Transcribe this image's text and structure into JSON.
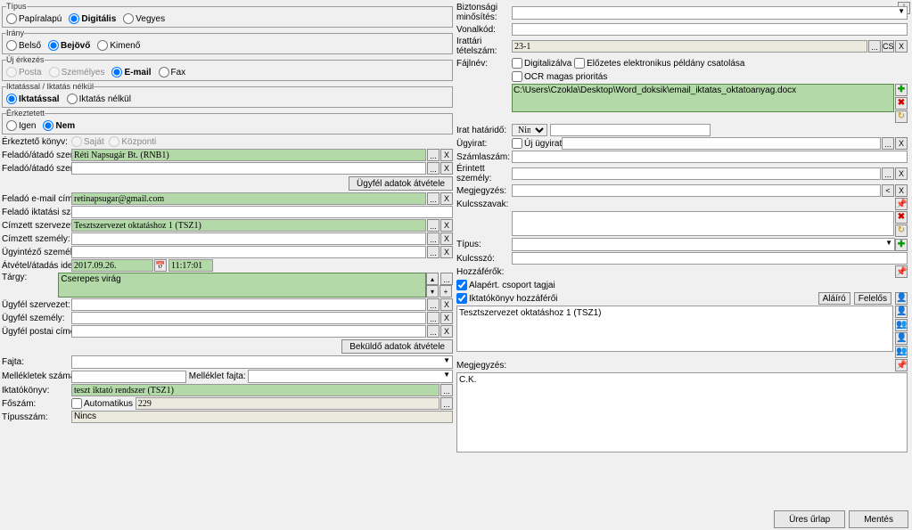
{
  "left": {
    "tipus_legend": "Típus",
    "tipus": {
      "papir": "Papíralapú",
      "digitalis": "Digitális",
      "vegyes": "Vegyes"
    },
    "irany_legend": "Irány",
    "irany": {
      "belso": "Belső",
      "bejovo": "Bejövő",
      "kimeno": "Kimenő"
    },
    "uterk_legend": "Új érkezés",
    "uterk": {
      "posta": "Posta",
      "szemelyes": "Személyes",
      "email": "E-mail",
      "fax": "Fax"
    },
    "ikt_legend": "Iktatással / Iktatás nélkül",
    "ikt": {
      "iktatassal": "Iktatással",
      "iktatas_nelkul": "Iktatás nélkül"
    },
    "erk_legend": "Érkeztetett",
    "erk": {
      "igen": "Igen",
      "nem": "Nem"
    },
    "konyv_label": "Érkeztető könyv:",
    "konyv_sajat": "Saját",
    "konyv_kozponti": "Központi",
    "felado_szerv_label": "Feladó/átadó szervezet:",
    "felado_szerv": "Réti Napsugár Bt. (RNB1)",
    "felado_szem_label": "Feladó/átadó személy:",
    "ugyfeladatok_btn": "Ügyfél adatok átvétele",
    "felado_email_label": "Feladó e-mail címe:",
    "felado_email": "retinapsugar@gmail.com",
    "felado_ikt_label": "Feladó iktatási száma:",
    "cimzett_szerv_label": "Címzett szervezet:",
    "cimzett_szerv": "Tesztszervezet oktatáshoz 1 (TSZ1)",
    "cimzett_szem_label": "Címzett személy:",
    "ugyintezo_label": "Ügyintéző személy:",
    "atvetel_label": "Átvétel/átadás ideje:",
    "atvetel_date": "2017.09.26.",
    "atvetel_time": "11:17:01",
    "targy_label": "Tárgy:",
    "targy": "Cserepes virág",
    "ugyfel_szerv_label": "Ügyfél szervezet:",
    "ugyfel_szem_label": "Ügyfél személy:",
    "ugyfel_cim_label": "Ügyfél postai címe:",
    "bekuld_btn": "Beküldő adatok átvétele",
    "fajta_label": "Fajta:",
    "mellekletek_label": "Mellékletek száma:",
    "melleklet_fajta": "Melléklet fajta:",
    "iktatokonyv_label": "Iktatókönyv:",
    "iktatokonyv": "teszt iktató rendszer (TSZ1)",
    "foszam_label": "Főszám:",
    "automatikus": "Automatikus",
    "foszam_val": "229",
    "tipusszam_label": "Típusszám:",
    "tipusszam": "Nincs"
  },
  "right": {
    "bizt_label": "Biztonsági minősítés:",
    "vonalkod_label": "Vonalkód:",
    "irattar_label": "Irattári tételszám:",
    "irattar_val": "23-1",
    "fajlnev_label": "Fájlnév:",
    "digit": "Digitalizálva",
    "elozetes": "Előzetes elektronikus példány csatolása",
    "ocr": "OCR magas prioritás",
    "filepath": "C:\\Users\\Czokla\\Desktop\\Word_doksik\\email_iktatas_oktatoanyag.docx",
    "cs": "CS",
    "x": "X",
    "irathat_label": "Irat határidő:",
    "irathat_val": "Nincs",
    "ugyirat_label": "Ügyirat:",
    "ujugyirat": "Új ügyirat",
    "szamlaszam": "Számlaszám:",
    "erintett": "Érintett személy:",
    "megjegyzes_label": "Megjegyzés:",
    "kulcsszavak": "Kulcsszavak:",
    "tipus2": "Típus:",
    "kulcsszo": "Kulcsszó:",
    "hozzaferok": "Hozzáférők:",
    "alapert_csoport": "Alapért. csoport tagjai",
    "ikt_hozz": "Iktatókönyv hozzáférői",
    "alairo_btn": "Aláíró",
    "felelos_btn": "Felelős",
    "hozza_item": "Tesztszervezet oktatáshoz 1 (TSZ1)",
    "megjegyzes2": "Megjegyzés:",
    "megj_val": "C.K."
  },
  "bottom": {
    "ures": "Üres űrlap",
    "mentes": "Mentés"
  }
}
